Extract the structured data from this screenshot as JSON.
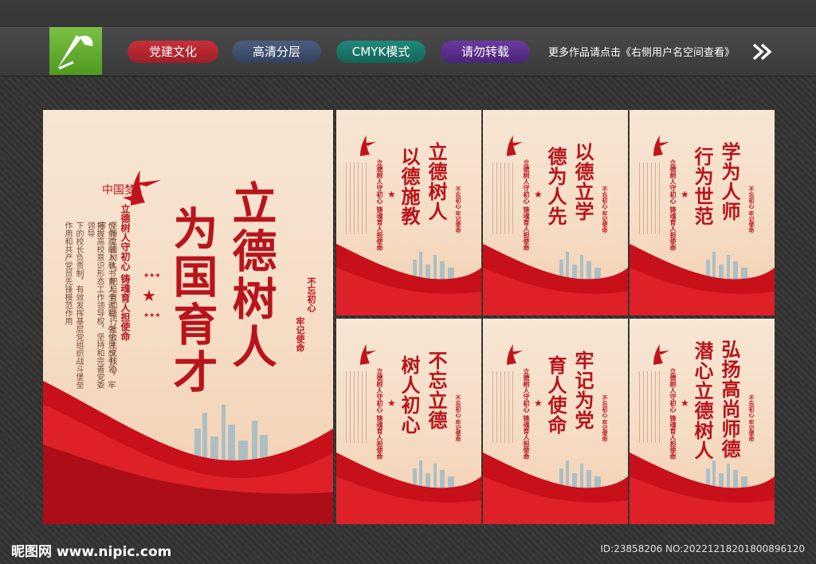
{
  "tags": [
    "党建文化",
    "高清分层",
    "CMYK模式",
    "请勿转载"
  ],
  "top_note": "更多作品请点击《右侧用户名空间查看》",
  "big_panel": {
    "logo_text": "中国梦",
    "title_col1": "立德树人",
    "title_col2": "为国育才",
    "subtitle": "立德树人守初心  铸魂育人担使命",
    "body_col1": "坚持立德树人，把培育和践行社会主义核心",
    "body_col2": "价值观融入教书育人全过程，强化思想引领，牢牢",
    "body_col3": "把握高校意识形态工作领导权，坚持和完善党委领导",
    "body_col4": "下的校长负责制，有效发挥基层党组织战斗堡垒",
    "body_col5": "作用和共产党员先锋模范作用",
    "seal_col1": "不忘初心",
    "seal_col2": "牢记使命"
  },
  "small_panels": [
    {
      "title_col1": "立德树人",
      "title_col2": "以德施教"
    },
    {
      "title_col1": "以德立学",
      "title_col2": "德为人先"
    },
    {
      "title_col1": "学为人师",
      "title_col2": "行为世范"
    },
    {
      "title_col1": "不忘立德",
      "title_col2": "树人初心"
    },
    {
      "title_col1": "牢记为党",
      "title_col2": "育人使命"
    },
    {
      "title_col1": "弘扬高尚师德",
      "title_col2": "潜心立德树人"
    }
  ],
  "small_panel_subtitle": "立德树人守初心  铸魂育人担使命",
  "small_panel_seal": "不忘初心  牢记使命",
  "watermark_left": "昵图网 www.nipic.com",
  "watermark_right": "ID:23858206 NO:20221218201800896120",
  "colors": {
    "accent_red": "#b8141c",
    "panel_bg": "#f7e6d4"
  }
}
